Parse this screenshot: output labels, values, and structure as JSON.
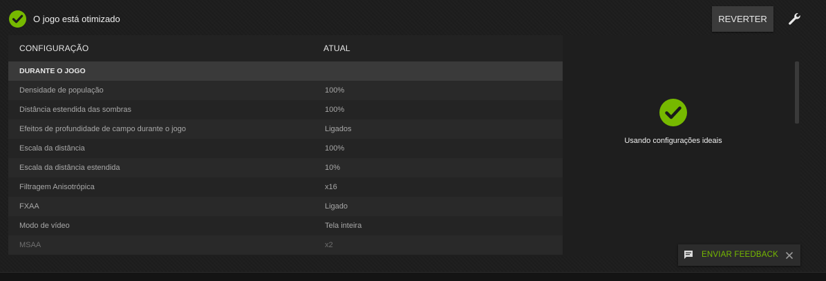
{
  "header": {
    "status_text": "O jogo está otimizado",
    "revert_label": "REVERTER"
  },
  "table": {
    "col_config": "CONFIGURAÇÃO",
    "col_current": "ATUAL",
    "section": "DURANTE O JOGO",
    "rows": [
      {
        "name": "Densidade de população",
        "value": "100%"
      },
      {
        "name": "Distância estendida das sombras",
        "value": "100%"
      },
      {
        "name": "Efeitos de profundidade de campo durante o jogo",
        "value": "Ligados"
      },
      {
        "name": "Escala da distância",
        "value": "100%"
      },
      {
        "name": "Escala da distância estendida",
        "value": "10%"
      },
      {
        "name": "Filtragem Anisotrópica",
        "value": "x16"
      },
      {
        "name": "FXAA",
        "value": "Ligado"
      },
      {
        "name": "Modo de vídeo",
        "value": "Tela inteira"
      },
      {
        "name": "MSAA",
        "value": "x2"
      }
    ]
  },
  "side": {
    "ideal_text": "Usando configurações ideais"
  },
  "feedback": {
    "label": "ENVIAR FEEDBACK"
  },
  "icons": {
    "status": "check-circle-icon",
    "settings": "wrench-icon",
    "feedback": "chat-icon",
    "close": "close-icon"
  },
  "colors": {
    "accent": "#76b900"
  }
}
